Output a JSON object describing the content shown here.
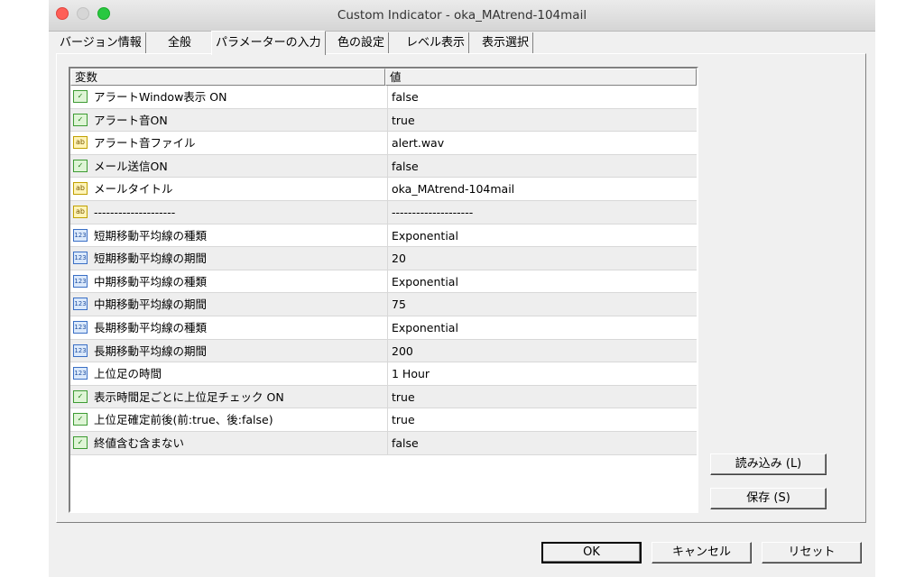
{
  "window": {
    "title": "Custom Indicator - oka_MAtrend-104mail"
  },
  "tabs": [
    {
      "label": "バージョン情報"
    },
    {
      "label": "全般"
    },
    {
      "label": "パラメーターの入力"
    },
    {
      "label": "色の設定"
    },
    {
      "label": "レベル表示"
    },
    {
      "label": "表示選択"
    }
  ],
  "active_tab": "パラメーターの入力",
  "grid": {
    "headers": {
      "variable": "変数",
      "value": "値"
    },
    "rows": [
      {
        "icon": "boolean-icon",
        "name": "アラートWindow表示 ON",
        "value": "false"
      },
      {
        "icon": "boolean-icon",
        "name": "アラート音ON",
        "value": "true"
      },
      {
        "icon": "string-icon",
        "name": "アラート音ファイル",
        "value": "alert.wav"
      },
      {
        "icon": "boolean-icon",
        "name": "メール送信ON",
        "value": "false"
      },
      {
        "icon": "string-icon",
        "name": "メールタイトル",
        "value": "oka_MAtrend-104mail"
      },
      {
        "icon": "string-icon",
        "name": "--------------------",
        "value": "--------------------"
      },
      {
        "icon": "integer-icon",
        "name": "短期移動平均線の種類",
        "value": "Exponential"
      },
      {
        "icon": "integer-icon",
        "name": "短期移動平均線の期間",
        "value": "20"
      },
      {
        "icon": "integer-icon",
        "name": "中期移動平均線の種類",
        "value": "Exponential"
      },
      {
        "icon": "integer-icon",
        "name": "中期移動平均線の期間",
        "value": "75"
      },
      {
        "icon": "integer-icon",
        "name": "長期移動平均線の種類",
        "value": "Exponential"
      },
      {
        "icon": "integer-icon",
        "name": "長期移動平均線の期間",
        "value": "200"
      },
      {
        "icon": "integer-icon",
        "name": "上位足の時間",
        "value": "1 Hour"
      },
      {
        "icon": "boolean-icon",
        "name": "表示時間足ごとに上位足チェック ON",
        "value": "true"
      },
      {
        "icon": "boolean-icon",
        "name": "上位足確定前後(前:true、後:false)",
        "value": "true"
      },
      {
        "icon": "boolean-icon",
        "name": "終値含む含まない",
        "value": "false"
      }
    ]
  },
  "side_buttons": {
    "load": "読み込み (L)",
    "save": "保存 (S)"
  },
  "footer_buttons": {
    "ok": "OK",
    "cancel": "キャンセル",
    "reset": "リセット"
  },
  "icon_glyphs": {
    "boolean-icon": "✓",
    "string-icon": "ab",
    "integer-icon": "123"
  },
  "colors": {
    "close": "#fe5f57",
    "minimize": "#d6d6d6",
    "maximize": "#28c840",
    "row_alt": "#eeeeee"
  }
}
